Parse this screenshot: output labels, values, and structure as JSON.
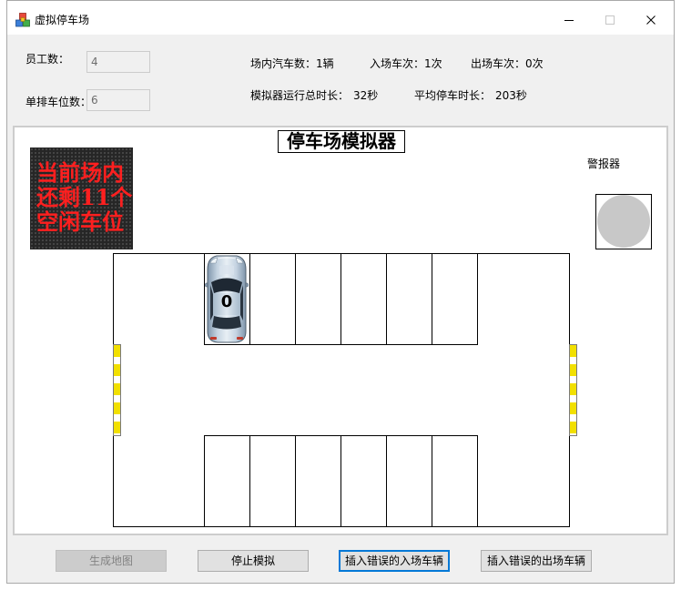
{
  "window": {
    "title": "虚拟停车场",
    "icon": "app-cubes-icon",
    "caption_icons": [
      "minimize-icon",
      "maximize-icon",
      "close-icon"
    ]
  },
  "settings": {
    "employees": {
      "label": "员工数：",
      "value": "4"
    },
    "row_spaces": {
      "label": "单排车位数：",
      "value": "6"
    }
  },
  "stats": {
    "cars_in_lot": {
      "label": "场内汽车数：",
      "value": "1辆"
    },
    "entries": {
      "label": "入场车次：",
      "value": "1次"
    },
    "exits": {
      "label": "出场车次：",
      "value": "0次"
    },
    "runtime": {
      "label": "模拟器运行总时长：",
      "value": "32秒"
    },
    "avg_parking": {
      "label": "平均停车时长：",
      "value": "203秒"
    }
  },
  "simulator": {
    "title": "停车场模拟器",
    "led_display": {
      "lines": [
        "当前场内",
        "还剩11个",
        "空闲车位"
      ]
    },
    "alarm": {
      "label": "警报器",
      "active": false
    },
    "parking": {
      "top_row": [
        {
          "occupied": true,
          "car_label": "0"
        },
        {
          "occupied": false
        },
        {
          "occupied": false
        },
        {
          "occupied": false
        },
        {
          "occupied": false
        },
        {
          "occupied": false
        }
      ],
      "bottom_row": [
        {
          "occupied": false
        },
        {
          "occupied": false
        },
        {
          "occupied": false
        },
        {
          "occupied": false
        },
        {
          "occupied": false
        },
        {
          "occupied": false
        }
      ]
    }
  },
  "buttons": {
    "generate_map": {
      "label": "生成地图",
      "enabled": false,
      "focused": false
    },
    "stop": {
      "label": "停止模拟",
      "enabled": true,
      "focused": false
    },
    "insert_wrong_entry": {
      "label": "插入错误的入场车辆",
      "enabled": true,
      "focused": true
    },
    "insert_wrong_exit": {
      "label": "插入错误的出场车辆",
      "enabled": true,
      "focused": false
    }
  },
  "colors": {
    "window_bg": "#f0f0f0",
    "focus_border": "#0078d7",
    "led_text": "#ff1f1f",
    "led_background": "#262626",
    "alarm_light": "#c8c8c8",
    "gate_yellow": "#f2e000",
    "gate_white": "#ffffff"
  }
}
